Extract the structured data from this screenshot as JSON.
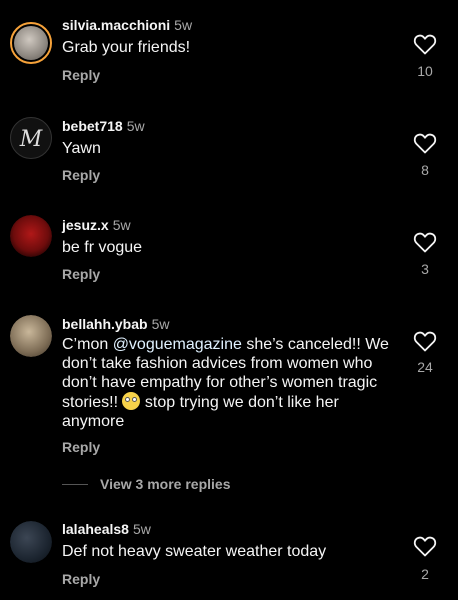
{
  "comments": [
    {
      "username": "silvia.macchioni",
      "time": "5w",
      "text": "Grab your friends!",
      "reply": "Reply",
      "likes": "10"
    },
    {
      "username": "bebet718",
      "time": "5w",
      "text": "Yawn",
      "reply": "Reply",
      "likes": "8"
    },
    {
      "username": "jesuz.x",
      "time": "5w",
      "text": "be fr vogue",
      "reply": "Reply",
      "likes": "3"
    },
    {
      "username": "bellahh.ybab",
      "time": "5w",
      "text_parts": {
        "a": "C’mon ",
        "mention": "@voguemagazine",
        "b": " she’s canceled!! We don’t take fashion advices from women who don’t have empathy for other’s women tragic stories!! ",
        "c": " stop trying we don’t like her anymore"
      },
      "reply": "Reply",
      "likes": "24",
      "emoji": "face-with-rolling-eyes"
    },
    {
      "username": "lalaheals8",
      "time": "5w",
      "text": "Def not heavy sweater weather today",
      "reply": "Reply",
      "likes": "2"
    }
  ],
  "view_more": "View 3 more replies",
  "colors": {
    "background": "#000000",
    "text": "#f5f5f5",
    "secondary": "#a8a8a8",
    "mention": "#e0f1ff",
    "story_ring": "#f6a23a"
  }
}
